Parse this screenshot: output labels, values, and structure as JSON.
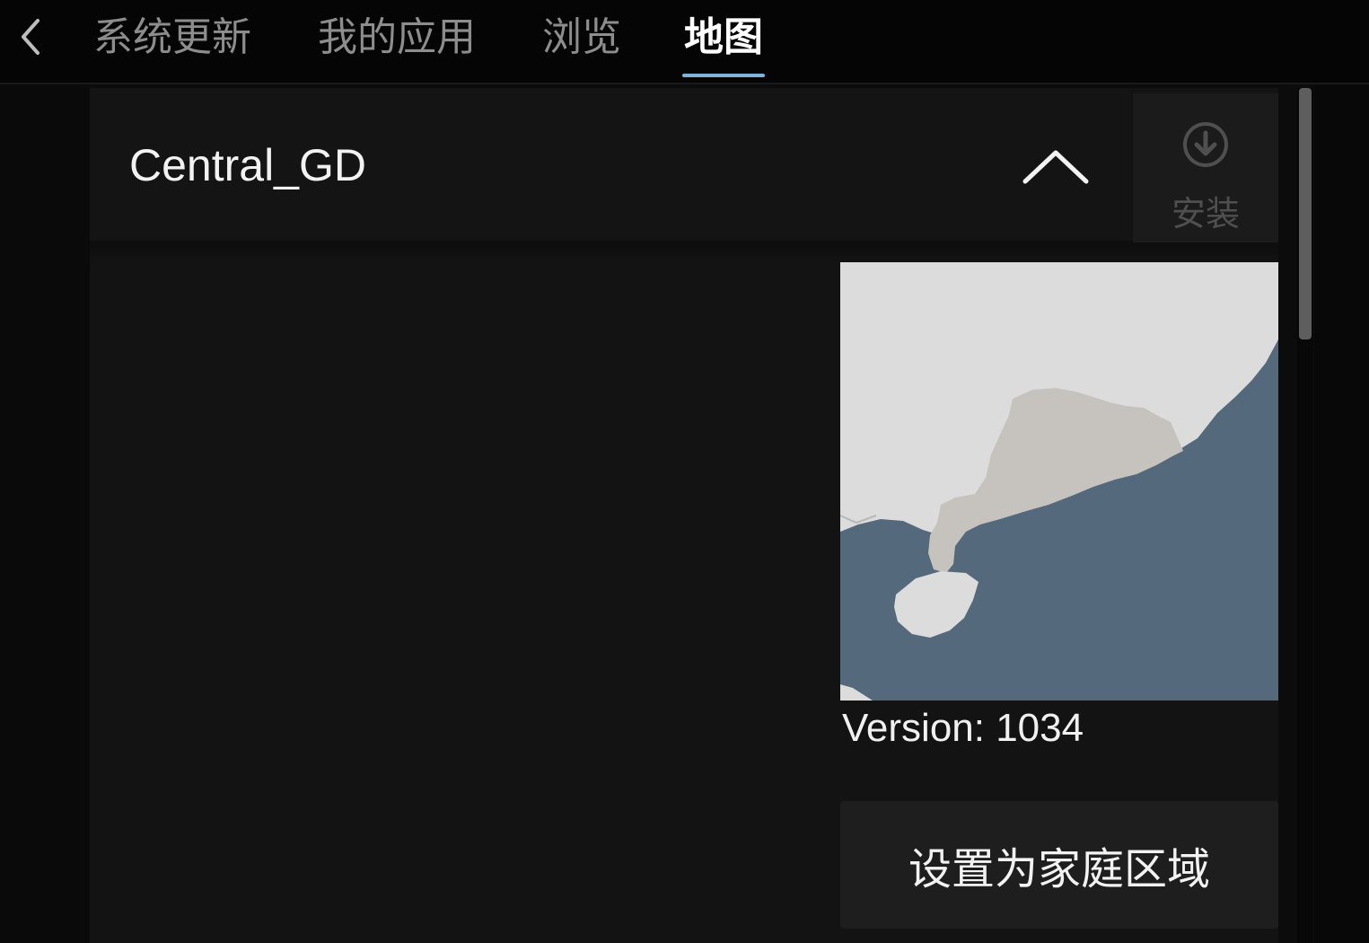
{
  "nav": {
    "tabs": [
      {
        "label": "系统更新",
        "active": false
      },
      {
        "label": "我的应用",
        "active": false
      },
      {
        "label": "浏览",
        "active": false
      },
      {
        "label": "地图",
        "active": true
      }
    ]
  },
  "region": {
    "name": "Central_GD",
    "expanded": true,
    "install_label": "安装",
    "version_text": "Version: 1034",
    "set_home_label": "设置为家庭区域"
  },
  "colors": {
    "accent_underline": "#7fb3dc",
    "map_land": "#dcdcdc",
    "map_region": "#c6c3be",
    "map_sea": "#546a7c"
  },
  "icons": {
    "back": "chevron-left-icon",
    "collapse": "chevron-up-icon",
    "install": "download-circle-icon"
  }
}
